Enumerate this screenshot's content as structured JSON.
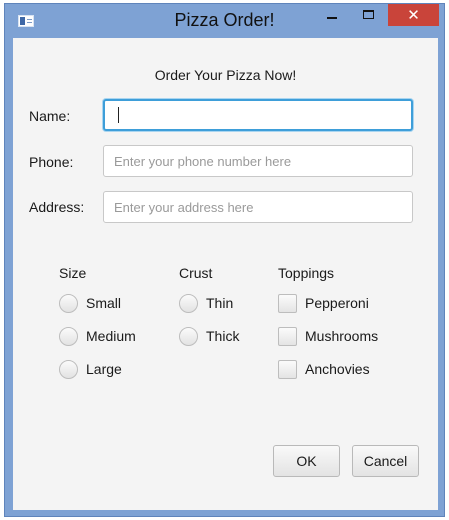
{
  "window": {
    "title": "Pizza Order!",
    "minimize_glyph": "–",
    "close_glyph": "✕",
    "icons": [
      "app-icon",
      "minimize-icon",
      "maximize-icon",
      "close-icon"
    ]
  },
  "form": {
    "heading": "Order Your Pizza Now!",
    "name": {
      "label": "Name:",
      "value": "",
      "placeholder": ""
    },
    "phone": {
      "label": "Phone:",
      "value": "",
      "placeholder": "Enter your phone number here"
    },
    "address": {
      "label": "Address:",
      "value": "",
      "placeholder": "Enter your address here"
    }
  },
  "size": {
    "title": "Size",
    "options": [
      {
        "label": "Small",
        "selected": false
      },
      {
        "label": "Medium",
        "selected": false
      },
      {
        "label": "Large",
        "selected": false
      }
    ]
  },
  "crust": {
    "title": "Crust",
    "options": [
      {
        "label": "Thin",
        "selected": false
      },
      {
        "label": "Thick",
        "selected": false
      }
    ]
  },
  "toppings": {
    "title": "Toppings",
    "options": [
      {
        "label": "Pepperoni",
        "checked": false
      },
      {
        "label": "Mushrooms",
        "checked": false
      },
      {
        "label": "Anchovies",
        "checked": false
      }
    ]
  },
  "buttons": {
    "ok": "OK",
    "cancel": "Cancel"
  },
  "colors": {
    "window_frame": "#7ea2d4",
    "close_button": "#c9443a",
    "focus_ring": "#3e9ed9",
    "client_background": "#f4f4f4"
  }
}
